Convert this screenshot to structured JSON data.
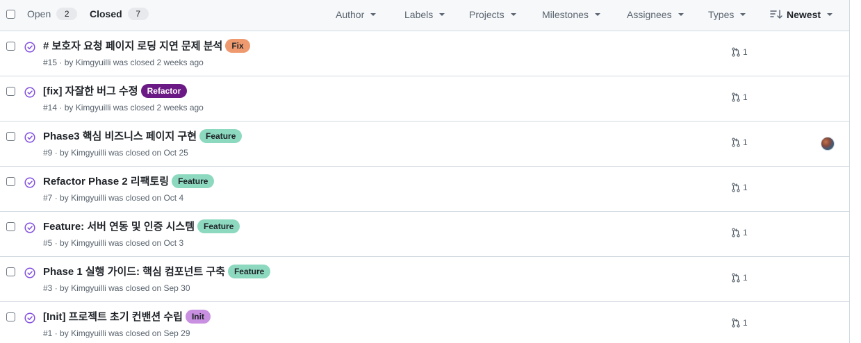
{
  "tabs": {
    "open_label": "Open",
    "open_count": "2",
    "closed_label": "Closed",
    "closed_count": "7"
  },
  "filters": {
    "author": "Author",
    "labels": "Labels",
    "projects": "Projects",
    "milestones": "Milestones",
    "assignees": "Assignees",
    "types": "Types",
    "sort": "Newest"
  },
  "issues": [
    {
      "title": "# 보호자 요청 페이지 로딩 지연 문제 분석",
      "label": "Fix",
      "label_bg": "#ee9a6e",
      "label_fg": "#1f2328",
      "number": "#15",
      "by": "by",
      "author": "Kimgyuilli",
      "closed": "was closed 2 weeks ago",
      "pr_count": "1",
      "assignee_avatar": false
    },
    {
      "title": "[fix] 자잘한 버그 수정",
      "label": "Refactor",
      "label_bg": "#6b1a85",
      "label_fg": "#ffffff",
      "number": "#14",
      "by": "by",
      "author": "Kimgyuilli",
      "closed": "was closed 2 weeks ago",
      "pr_count": "1",
      "assignee_avatar": false
    },
    {
      "title": "Phase3 핵심 비즈니스 페이지 구현",
      "label": "Feature",
      "label_bg": "#8dd9bf",
      "label_fg": "#1f2328",
      "number": "#9",
      "by": "by",
      "author": "Kimgyuilli",
      "closed": "was closed on Oct 25",
      "pr_count": "1",
      "assignee_avatar": true
    },
    {
      "title": "Refactor Phase 2 리팩토링",
      "label": "Feature",
      "label_bg": "#8dd9bf",
      "label_fg": "#1f2328",
      "number": "#7",
      "by": "by",
      "author": "Kimgyuilli",
      "closed": "was closed on Oct 4",
      "pr_count": "1",
      "assignee_avatar": false
    },
    {
      "title": "Feature: 서버 연동 및 인증 시스템",
      "label": "Feature",
      "label_bg": "#8dd9bf",
      "label_fg": "#1f2328",
      "number": "#5",
      "by": "by",
      "author": "Kimgyuilli",
      "closed": "was closed on Oct 3",
      "pr_count": "1",
      "assignee_avatar": false
    },
    {
      "title": "Phase 1 실행 가이드: 핵심 컴포넌트 구축",
      "label": "Feature",
      "label_bg": "#8dd9bf",
      "label_fg": "#1f2328",
      "number": "#3",
      "by": "by",
      "author": "Kimgyuilli",
      "closed": "was closed on Sep 30",
      "pr_count": "1",
      "assignee_avatar": false
    },
    {
      "title": "[Init] 프로젝트 초기 컨밴션 수립",
      "label": "Init",
      "label_bg": "#c98fe0",
      "label_fg": "#1f2328",
      "number": "#1",
      "by": "by",
      "author": "Kimgyuilli",
      "closed": "was closed on Sep 29",
      "pr_count": "1",
      "assignee_avatar": false
    }
  ],
  "icons": {
    "closed_issue": "check-circle-icon",
    "linked_pr": "git-pull-request-icon",
    "sort": "sort-desc-icon",
    "dropdown": "triangle-down-icon"
  },
  "colors": {
    "closed_icon": "#8250df",
    "border": "#d1d9e0",
    "header_bg": "#f6f8fa",
    "muted_text": "#59636e"
  }
}
